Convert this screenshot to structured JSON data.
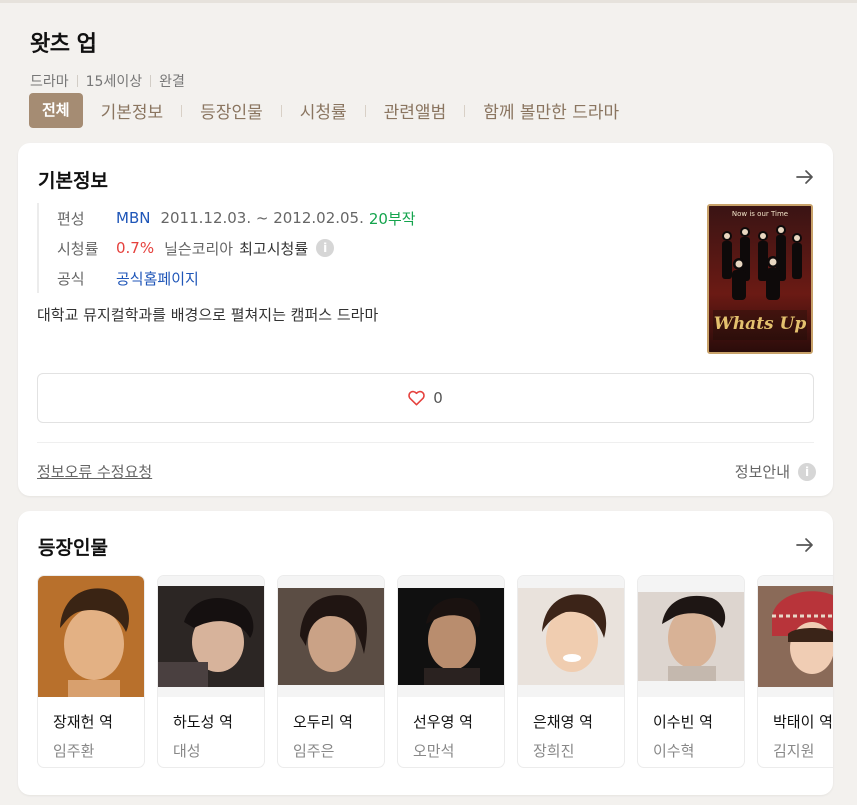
{
  "title": "왓츠 업",
  "meta": [
    "드라마",
    "15세이상",
    "완결"
  ],
  "tabs": [
    "전체",
    "기본정보",
    "등장인물",
    "시청률",
    "관련앨범",
    "함께 볼만한 드라마"
  ],
  "basic": {
    "heading": "기본정보",
    "broadcast_label": "편성",
    "channel": "MBN",
    "period": "2011.12.03. ~ 2012.02.05.",
    "episodes": "20부작",
    "rating_label": "시청률",
    "rating": "0.7%",
    "rating_source": "닐슨코리아",
    "rating_desc": "최고시청률",
    "official_label": "공식",
    "official_link": "공식홈페이지",
    "description": "대학교 뮤지컬학과를 배경으로 펼쳐지는 캠퍼스 드라마",
    "poster_title": "Whats Up",
    "poster_subtitle": "Now is our Time",
    "likes": "0",
    "report": "정보오류 수정요청",
    "guide": "정보안내"
  },
  "cast": {
    "heading": "등장인물",
    "people": [
      {
        "role": "장재헌 역",
        "actor": "임주환"
      },
      {
        "role": "하도성 역",
        "actor": "대성"
      },
      {
        "role": "오두리 역",
        "actor": "임주은"
      },
      {
        "role": "선우영 역",
        "actor": "오만석"
      },
      {
        "role": "은채영 역",
        "actor": "장희진"
      },
      {
        "role": "이수빈 역",
        "actor": "이수혁"
      },
      {
        "role": "박태이 역",
        "actor": "김지원"
      }
    ]
  },
  "colors": {
    "tab_active": "#a58c73",
    "tab_text": "#8a7560",
    "link": "#1f56b8",
    "episodes": "#14a44d",
    "rating": "#e5413d",
    "heart": "#e5413d"
  },
  "icons": {
    "arrow": "arrow-right-icon",
    "info": "info-circle-icon",
    "like": "heart-icon"
  }
}
